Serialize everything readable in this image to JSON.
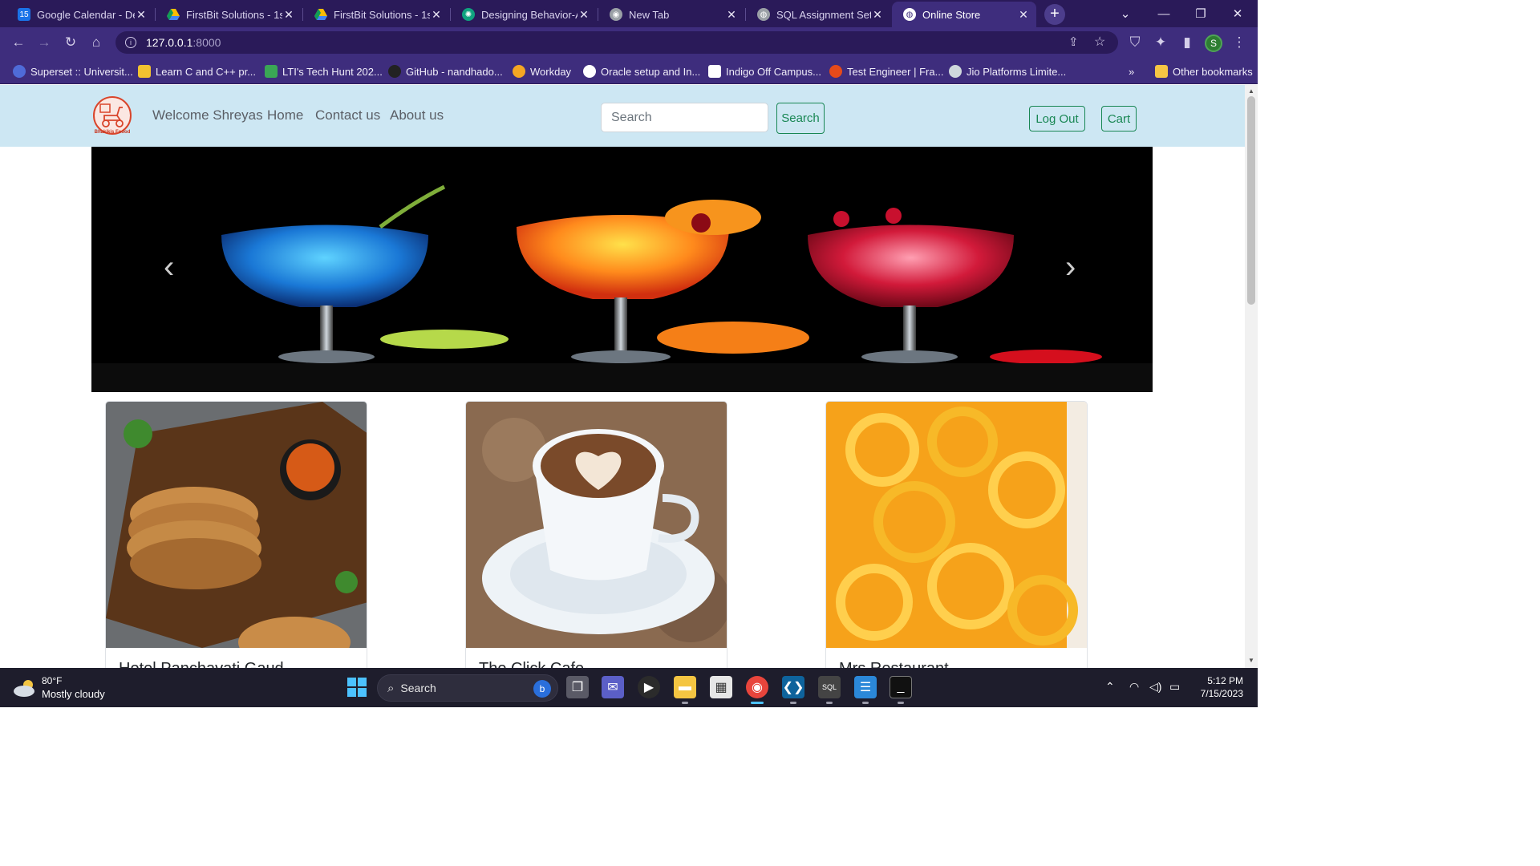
{
  "browser": {
    "tabs": [
      {
        "title": "Google Calendar - De",
        "icon": "calendar-icon",
        "color": "#1a73e8"
      },
      {
        "title": "FirstBit Solutions - 1st",
        "icon": "google-drive-icon",
        "color": "#fbbc04"
      },
      {
        "title": "FirstBit Solutions - 1st",
        "icon": "google-drive-icon",
        "color": "#fbbc04"
      },
      {
        "title": "Designing Behavior-A",
        "icon": "openai-icon",
        "color": "#10a37f"
      },
      {
        "title": "New Tab",
        "icon": "chrome-icon",
        "color": "#9aa0a6"
      },
      {
        "title": "SQL Assignment Set",
        "icon": "globe-icon",
        "color": "#9aa0a6"
      },
      {
        "title": "Online Store",
        "icon": "globe-icon",
        "color": "#ffffff"
      }
    ],
    "active_tab": 6,
    "url_host": "127.0.0.1",
    "url_port": ":8000",
    "profile_initial": "S",
    "bookmarks": [
      {
        "label": "Superset :: Universit...",
        "color": "#4f6bd8"
      },
      {
        "label": "Learn C and C++ pr...",
        "color": "#f2c230"
      },
      {
        "label": "LTI's Tech Hunt 202...",
        "color": "#3aa655"
      },
      {
        "label": "GitHub - nandhado...",
        "color": "#222222"
      },
      {
        "label": "Workday",
        "color": "#f5a623"
      },
      {
        "label": "Oracle setup and In...",
        "color": "#ffffff"
      },
      {
        "label": "Indigo Off Campus...",
        "color": "#ffffff"
      },
      {
        "label": "Test Engineer | Fra...",
        "color": "#e64a19"
      },
      {
        "label": "Jio Platforms Limite...",
        "color": "#cfd8dc"
      }
    ],
    "bookmarks_overflow": "»",
    "other_bookmarks": "Other bookmarks"
  },
  "site": {
    "logo_text": "Bhakikis Foood",
    "nav": [
      "Welcome Shreyas",
      "Home",
      "Contact us",
      "About us"
    ],
    "search_placeholder": "Search",
    "search_button": "Search",
    "logout_button": "Log Out",
    "cart_button": "Cart",
    "carousel": {
      "prev": "‹",
      "next": "›"
    },
    "cards": [
      {
        "title": "Hotel Panchavati Gaud",
        "image": "paratha"
      },
      {
        "title": "The Click Cafe",
        "image": "cappuccino"
      },
      {
        "title": "Mrs Restaurant",
        "image": "jalebi"
      }
    ]
  },
  "taskbar": {
    "temperature": "80°F",
    "weather": "Mostly cloudy",
    "search_label": "Search",
    "time": "5:12 PM",
    "date": "7/15/2023"
  },
  "colors": {
    "navbar_bg": "#cde7f3",
    "button_green": "#198754",
    "chrome_frame": "#3e2d7d"
  }
}
